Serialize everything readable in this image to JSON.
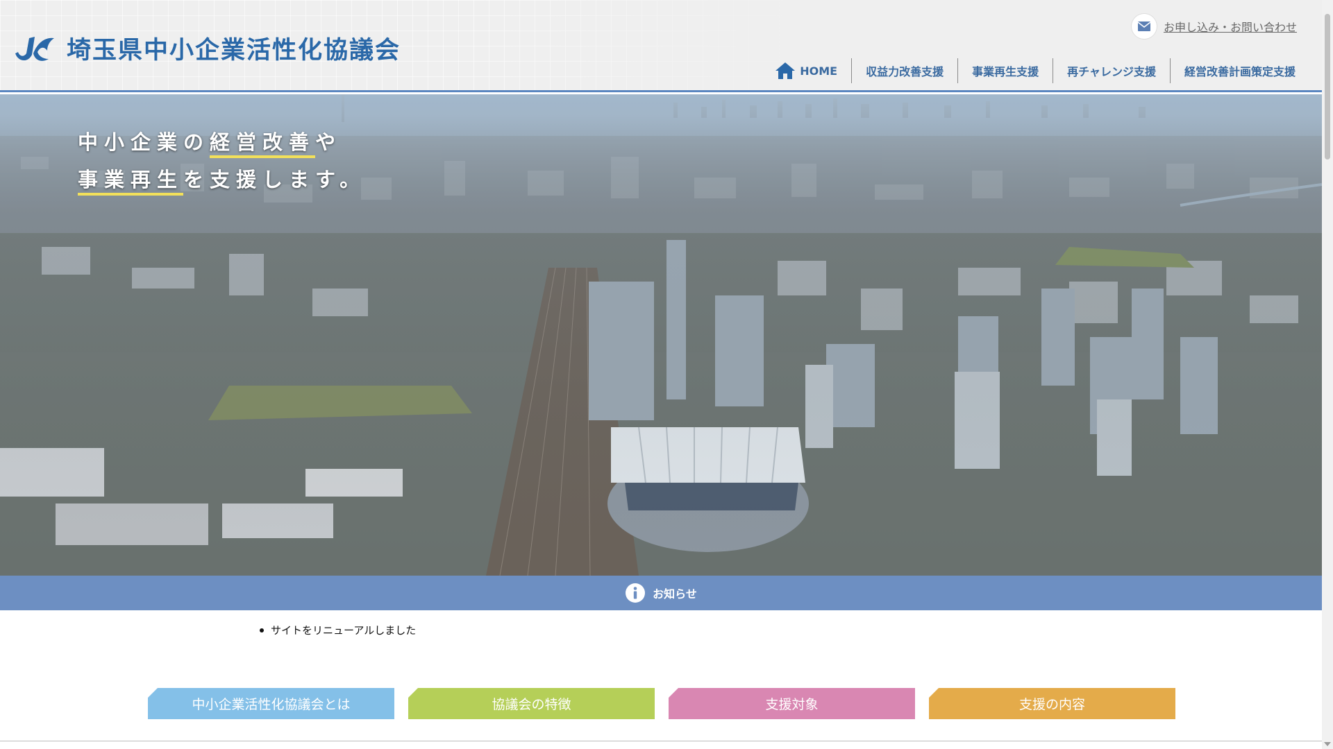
{
  "header": {
    "logo_text": "埼玉県中小企業活性化協議会",
    "contact_label": "お申し込み・お問い合わせ",
    "contact_icon": "mail-icon",
    "nav": [
      {
        "label": "HOME",
        "icon": "home-icon"
      },
      {
        "label": "収益力改善支援"
      },
      {
        "label": "事業再生支援"
      },
      {
        "label": "再チャレンジ支援"
      },
      {
        "label": "経営改善計画策定支援"
      }
    ]
  },
  "hero": {
    "line1_a": "中小企業の",
    "line1_b": "経営改善",
    "line1_c": "や",
    "line2_a": "事業再生",
    "line2_b": "を支援します。"
  },
  "news": {
    "title": "お知らせ",
    "icon": "info-icon",
    "items": [
      "サイトをリニューアルしました"
    ]
  },
  "tabs": [
    {
      "label": "中小企業活性化協議会とは",
      "color": "#84c0e8"
    },
    {
      "label": "協議会の特徴",
      "color": "#b5cf58"
    },
    {
      "label": "支援対象",
      "color": "#d987b2"
    },
    {
      "label": "支援の内容",
      "color": "#e4ab4a"
    }
  ],
  "colors": {
    "brand": "#2a68a8",
    "news_bar": "#6d8fc2",
    "highlight": "#f2e05a"
  }
}
